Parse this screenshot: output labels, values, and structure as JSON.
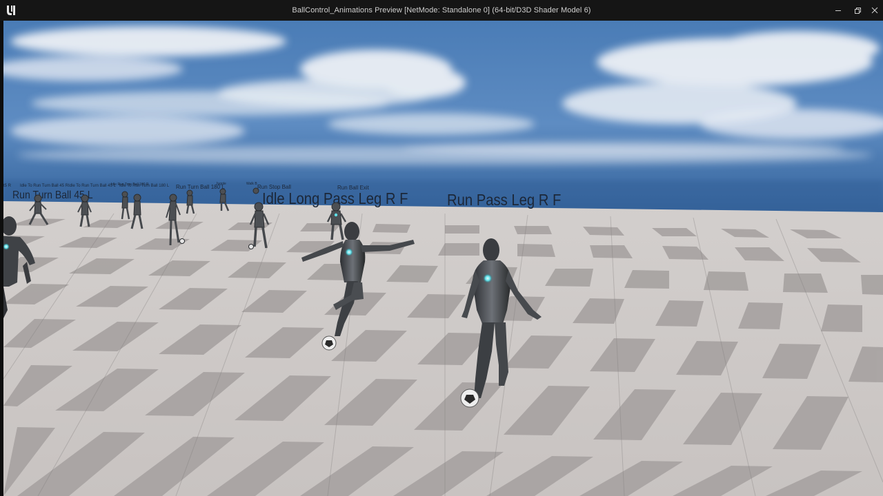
{
  "window": {
    "title": "BallControl_Animations Preview [NetMode: Standalone 0]  (64-bit/D3D Shader Model 6)",
    "logo_icon": "unreal-engine-logo-icon",
    "controls": [
      "minimize-icon",
      "restore-icon",
      "close-icon"
    ]
  },
  "scene": {
    "sky_top": "#3d6ea6",
    "horizon": "#2e5c94",
    "floor_light": "#c9c4c2",
    "floor_dark": "#a7a2a1",
    "labels": {
      "run_turn_ball_45": "Run Turn Ball 45 L",
      "idle_to_run_turn_ball_45_r": "Idle To Run Turn Ball 45 R",
      "idle_to_run_turn_ball_45_l": "Idle To Run Turn Ball 45 L",
      "idle_to_run_turn_ball_180": "Idle To Run Turn Ball 180 L",
      "idle_run_turn_ball_180_r": "Idle Run Turn Ball 180 R",
      "run_turn_ball_180": "Run Turn Ball 180 L",
      "juggle": "Juggle",
      "walk": "Walk B",
      "run_stop_ball": "Run Stop Ball",
      "run_ball_exit": "Run Ball Exit",
      "idle_long_pass": "Idle Long Pass Leg R F",
      "run_pass": "Run Pass Leg R F",
      "edge_label": "t5 R"
    }
  }
}
